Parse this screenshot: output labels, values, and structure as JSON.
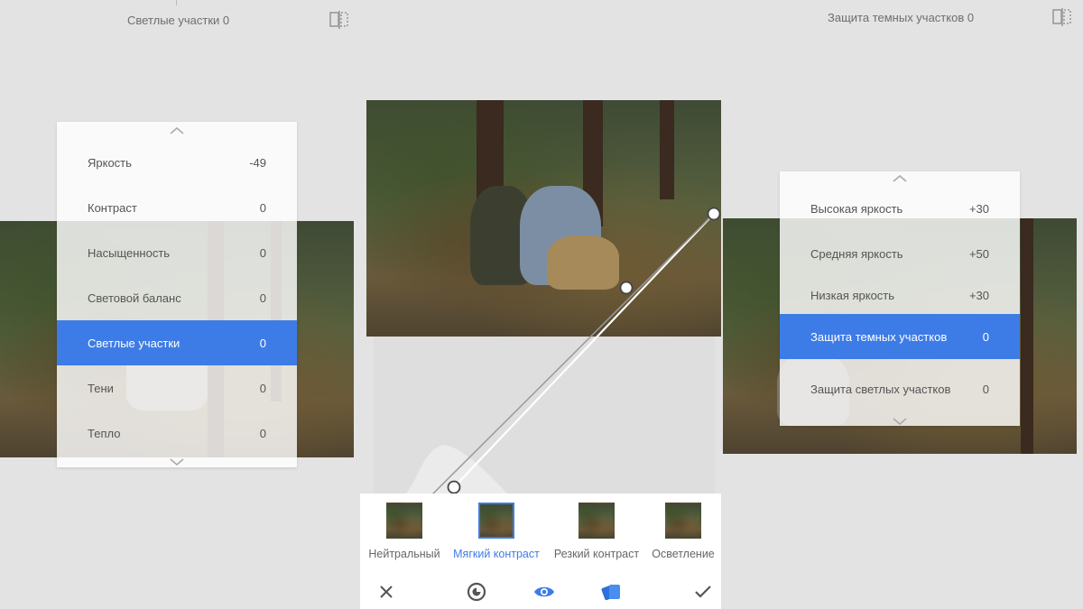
{
  "top_bar": {
    "left_status": "Светлые участки 0",
    "right_status": "Защита темных участков 0"
  },
  "left_menu": {
    "items": [
      {
        "label": "Яркость",
        "value": "-49"
      },
      {
        "label": "Контраст",
        "value": "0"
      },
      {
        "label": "Насыщенность",
        "value": "0"
      },
      {
        "label": "Световой баланс",
        "value": "0"
      },
      {
        "label": "Светлые участки",
        "value": "0"
      },
      {
        "label": "Тени",
        "value": "0"
      },
      {
        "label": "Тепло",
        "value": "0"
      }
    ],
    "selected_index": 4
  },
  "right_menu": {
    "items": [
      {
        "label": "Высокая яркость",
        "value": "+30"
      },
      {
        "label": "Средняя яркость",
        "value": "+50"
      },
      {
        "label": "Низкая яркость",
        "value": "+30"
      },
      {
        "label": "Защита темных участков",
        "value": "0"
      },
      {
        "label": "Защита светлых участков",
        "value": "0"
      }
    ],
    "selected_index": 3
  },
  "presets": [
    {
      "label": "Нейтральный"
    },
    {
      "label": "Мягкий контраст"
    },
    {
      "label": "Резкий контраст"
    },
    {
      "label": "Осветление"
    }
  ],
  "selected_preset": 1,
  "actions": {
    "cancel_icon": "close-icon",
    "style_icon": "style-brush-icon",
    "preview_icon": "eye-icon",
    "channel_icon": "color-channel-icon",
    "apply_icon": "checkmark-icon"
  },
  "colors": {
    "accent": "#3d7ce6",
    "background": "#e3e3e3"
  }
}
